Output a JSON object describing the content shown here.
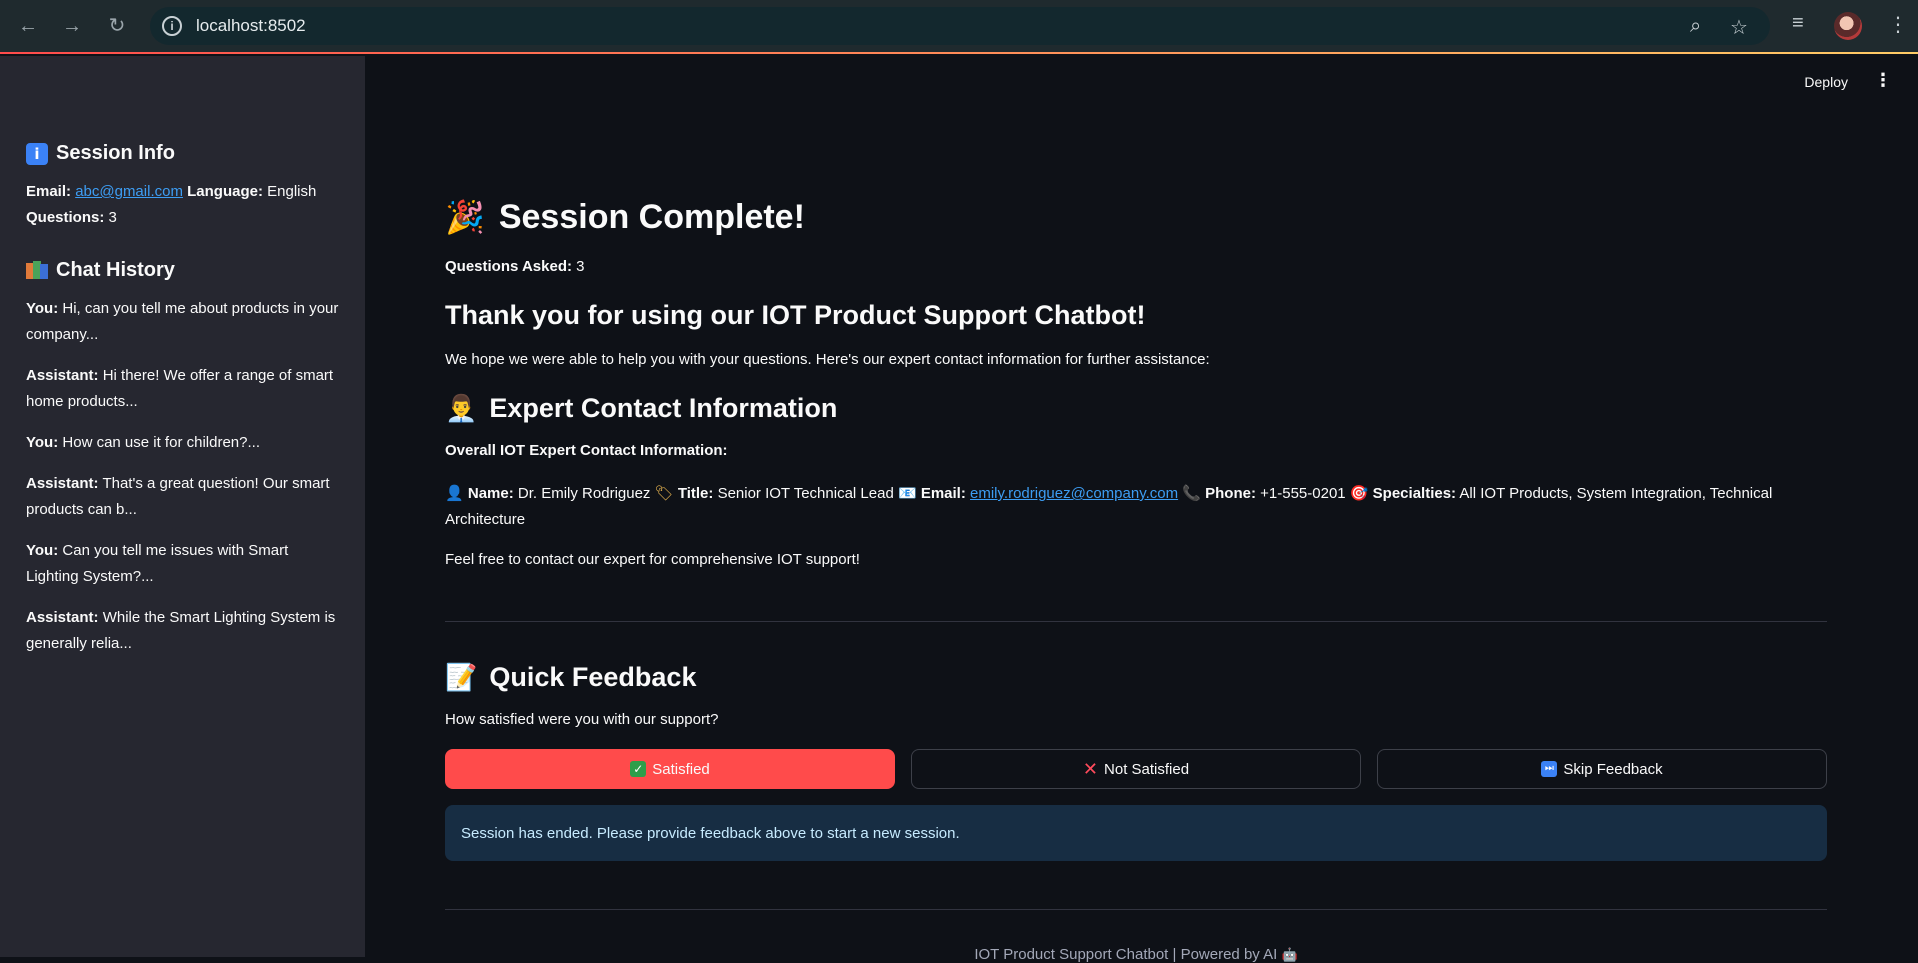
{
  "browser": {
    "url": "localhost:8502",
    "back_icon": "back-arrow-icon",
    "forward_icon": "forward-arrow-icon",
    "reload_icon": "reload-icon"
  },
  "header": {
    "deploy_label": "Deploy"
  },
  "sidebar": {
    "session_info": {
      "heading": "Session Info",
      "email_label": "Email:",
      "email_value": "abc@gmail.com",
      "language_label": "Language:",
      "language_value": "English",
      "questions_label": "Questions:",
      "questions_value": "3"
    },
    "chat_history": {
      "heading": "Chat History",
      "items": [
        {
          "role": "You:",
          "text": "Hi, can you tell me about products in your company..."
        },
        {
          "role": "Assistant:",
          "text": "Hi there! We offer a range of smart home products..."
        },
        {
          "role": "You:",
          "text": "How can use it for children?..."
        },
        {
          "role": "Assistant:",
          "text": "That's a great question! Our smart products can b..."
        },
        {
          "role": "You:",
          "text": "Can you tell me issues with Smart Lighting System?..."
        },
        {
          "role": "Assistant:",
          "text": "While the Smart Lighting System is generally relia..."
        }
      ]
    }
  },
  "main": {
    "title": "Session Complete!",
    "questions_asked_label": "Questions Asked:",
    "questions_asked_value": "3",
    "thanks_heading": "Thank you for using our IOT Product Support Chatbot!",
    "intro": "We hope we were able to help you with your questions. Here's our expert contact information for further assistance:",
    "expert_heading": "Expert Contact Information",
    "overall_label": "Overall IOT Expert Contact Information:",
    "expert": {
      "name_label": "Name:",
      "name": "Dr. Emily Rodriguez",
      "title_label": "Title:",
      "title": "Senior IOT Technical Lead",
      "email_label": "Email:",
      "email": "emily.rodriguez@company.com",
      "phone_label": "Phone:",
      "phone": "+1-555-0201",
      "specialties_label": "Specialties:",
      "specialties": "All IOT Products, System Integration, Technical Architecture"
    },
    "contact_note": "Feel free to contact our expert for comprehensive IOT support!",
    "feedback_heading": "Quick Feedback",
    "feedback_question": "How satisfied were you with our support?",
    "buttons": {
      "satisfied": "Satisfied",
      "not_satisfied": "Not Satisfied",
      "skip": "Skip Feedback"
    },
    "info_message": "Session has ended. Please provide feedback above to start a new session.",
    "footer": "IOT Product Support Chatbot | Powered by AI"
  },
  "colors": {
    "primary": "#ff4b4b",
    "link": "#3d9df3",
    "info_bg": "#172d43",
    "sidebar_bg": "#262730",
    "main_bg": "#0e1117"
  }
}
